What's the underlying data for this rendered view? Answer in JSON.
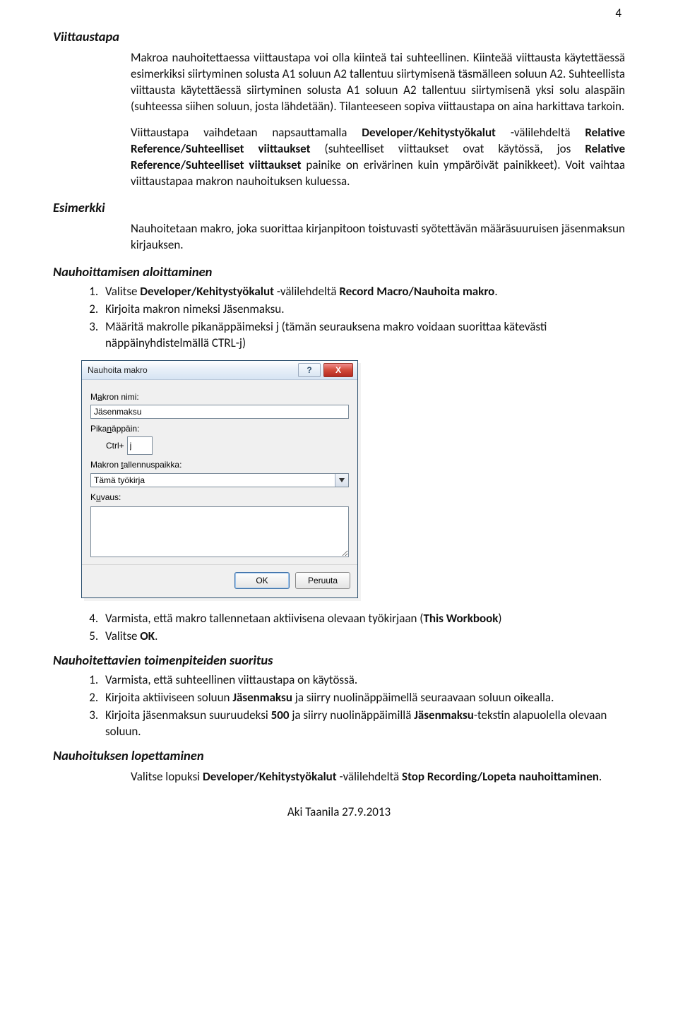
{
  "pagenum": "4",
  "h1": "Viittaustapa",
  "p1": "Makroa nauhoitettaessa viittaustapa voi olla kiinteä tai suhteellinen. Kiinteää viittausta käytettäessä esimerkiksi siirtyminen solusta A1 soluun A2 tallentuu siirtymisenä täsmälleen soluun A2. Suhteellista viittausta käytettäessä siirtyminen solusta A1 soluun A2 tallentuu siirtymisenä yksi solu alaspäin (suhteessa siihen soluun, josta lähdetään). Tilanteeseen sopiva viittaustapa on aina harkittava tarkoin.",
  "p2_a": "Viittaustapa vaihdetaan napsauttamalla ",
  "p2_b": "Developer/Kehitystyökalut ",
  "p2_c": "-välilehdeltä ",
  "p2_d": "Relative Reference/Suhteelliset viittaukset",
  "p2_e": " (suhteelliset viittaukset ovat käytössä, jos ",
  "p2_f": "Relative Reference/Suhteelliset viittaukset",
  "p2_g": " painike on erivärinen kuin ympäröivät painikkeet). Voit vaihtaa viittaustapaa makron nauhoituksen kuluessa.",
  "h2": "Esimerkki",
  "p3": "Nauhoitetaan makro, joka suorittaa kirjanpitoon toistuvasti syötettävän määräsuuruisen jäsenmaksun kirjauksen.",
  "h3": "Nauhoittamisen aloittaminen",
  "list1": {
    "i1_a": "Valitse ",
    "i1_b": "Developer/Kehitystyökalut ",
    "i1_c": "-välilehdeltä ",
    "i1_d": "Record Macro/Nauhoita makro",
    "i1_e": ".",
    "i2": "Kirjoita makron nimeksi Jäsenmaksu.",
    "i3_a": "Määritä makrolle pikanäppäimeksi j (tämän seurauksena makro voidaan suorittaa kätevästi näppäinyhdistelmällä ",
    "i3_b": "CTRL",
    "i3_c": "-j)"
  },
  "dialog": {
    "title": "Nauhoita makro",
    "name_label_pre": "M",
    "name_label_acc": "a",
    "name_label_post": "kron nimi:",
    "name_value": "Jäsenmaksu",
    "shortcut_label_pre": "Pika",
    "shortcut_label_acc": "n",
    "shortcut_label_post": "äppäin:",
    "shortcut_ctrl": "Ctrl+",
    "shortcut_value": "j",
    "store_label_pre": "Makron ",
    "store_label_acc": "t",
    "store_label_post": "allennuspaikka:",
    "store_value": "Tämä työkirja",
    "desc_label_pre": "K",
    "desc_label_acc": "u",
    "desc_label_post": "vaus:",
    "ok": "OK",
    "cancel": "Peruuta",
    "help": "?",
    "close": "X"
  },
  "list2": {
    "i4_a": "Varmista, että makro tallennetaan aktiivisena olevaan työkirjaan (",
    "i4_b": "This Workbook",
    "i4_c": ")",
    "i5_a": "Valitse ",
    "i5_b": "OK",
    "i5_c": "."
  },
  "h4": "Nauhoitettavien toimenpiteiden suoritus",
  "list3": {
    "i1": "Varmista, että suhteellinen viittaustapa on käytössä.",
    "i2_a": "Kirjoita aktiiviseen soluun ",
    "i2_b": "Jäsenmaksu",
    "i2_c": " ja siirry nuolinäppäimellä seuraavaan soluun oikealla.",
    "i3_a": "Kirjoita jäsenmaksun suuruudeksi ",
    "i3_b": "500",
    "i3_c": " ja siirry nuolinäppäimillä ",
    "i3_d": "Jäsenmaksu",
    "i3_e": "-tekstin alapuolella olevaan soluun."
  },
  "h5": "Nauhoituksen lopettaminen",
  "p4_a": "Valitse lopuksi ",
  "p4_b": "Developer/Kehitystyökalut ",
  "p4_c": "-välilehdeltä ",
  "p4_d": "Stop Recording/Lopeta nauhoittaminen",
  "p4_e": ".",
  "footer": "Aki Taanila 27.9.2013"
}
